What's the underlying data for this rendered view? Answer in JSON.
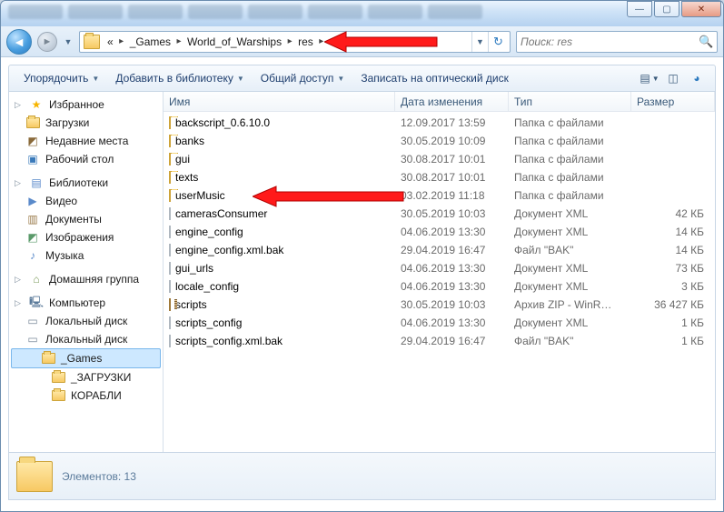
{
  "window": {
    "min": "—",
    "max": "▢",
    "close": "✕"
  },
  "breadcrumbs": {
    "ellipsis": "«",
    "p0": "_Games",
    "p1": "World_of_Warships",
    "p2": "res"
  },
  "search": {
    "placeholder": "Поиск: res"
  },
  "toolbar": {
    "organize": "Упорядочить",
    "addToLibrary": "Добавить в библиотеку",
    "share": "Общий доступ",
    "burn": "Записать на оптический диск"
  },
  "columns": {
    "name": "Имя",
    "date": "Дата изменения",
    "type": "Тип",
    "size": "Размер"
  },
  "sidebar": {
    "fav": "Избранное",
    "downloads": "Загрузки",
    "recent": "Недавние места",
    "desktop": "Рабочий стол",
    "libraries": "Библиотеки",
    "videos": "Видео",
    "documents": "Документы",
    "pictures": "Изображения",
    "music": "Музыка",
    "homegroup": "Домашняя группа",
    "computer": "Компьютер",
    "localC": "Локальный диск",
    "localD": "Локальный диск",
    "games": "_Games",
    "zag": "_ЗАГРУЗКИ",
    "kor": "КОРАБЛИ"
  },
  "files": [
    {
      "name": "backscript_0.6.10.0",
      "date": "12.09.2017 13:59",
      "type": "Папка с файлами",
      "size": "",
      "kind": "folder"
    },
    {
      "name": "banks",
      "date": "30.05.2019 10:09",
      "type": "Папка с файлами",
      "size": "",
      "kind": "folder"
    },
    {
      "name": "gui",
      "date": "30.08.2017 10:01",
      "type": "Папка с файлами",
      "size": "",
      "kind": "folder"
    },
    {
      "name": "texts",
      "date": "30.08.2017 10:01",
      "type": "Папка с файлами",
      "size": "",
      "kind": "folder"
    },
    {
      "name": "userMusic",
      "date": "03.02.2019 11:18",
      "type": "Папка с файлами",
      "size": "",
      "kind": "folder"
    },
    {
      "name": "camerasConsumer",
      "date": "30.05.2019 10:03",
      "type": "Документ XML",
      "size": "42 КБ",
      "kind": "xml"
    },
    {
      "name": "engine_config",
      "date": "04.06.2019 13:30",
      "type": "Документ XML",
      "size": "14 КБ",
      "kind": "xml"
    },
    {
      "name": "engine_config.xml.bak",
      "date": "29.04.2019 16:47",
      "type": "Файл \"BAK\"",
      "size": "14 КБ",
      "kind": "file"
    },
    {
      "name": "gui_urls",
      "date": "04.06.2019 13:30",
      "type": "Документ XML",
      "size": "73 КБ",
      "kind": "xml"
    },
    {
      "name": "locale_config",
      "date": "04.06.2019 13:30",
      "type": "Документ XML",
      "size": "3 КБ",
      "kind": "xml"
    },
    {
      "name": "scripts",
      "date": "30.05.2019 10:03",
      "type": "Архив ZIP - WinR…",
      "size": "36 427 КБ",
      "kind": "zip"
    },
    {
      "name": "scripts_config",
      "date": "04.06.2019 13:30",
      "type": "Документ XML",
      "size": "1 КБ",
      "kind": "xml"
    },
    {
      "name": "scripts_config.xml.bak",
      "date": "29.04.2019 16:47",
      "type": "Файл \"BAK\"",
      "size": "1 КБ",
      "kind": "file"
    }
  ],
  "status": {
    "count": "Элементов: 13"
  }
}
